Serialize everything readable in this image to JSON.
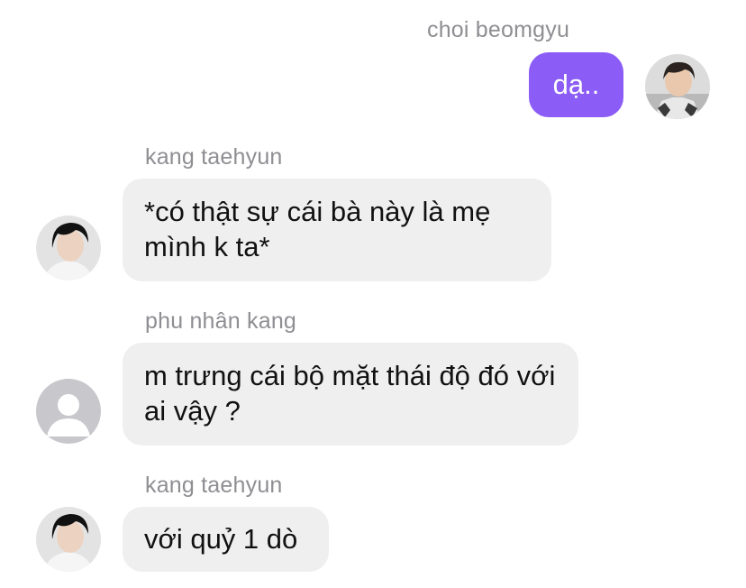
{
  "messages": [
    {
      "sender": "choi beomgyu",
      "text": "dạ..",
      "direction": "outgoing",
      "avatar_icon": "user-photo-avatar-icon"
    },
    {
      "sender": "kang taehyun",
      "text": "*có thật sự cái bà này là mẹ mình k ta*",
      "direction": "incoming",
      "avatar_icon": "user-photo-avatar-icon"
    },
    {
      "sender": "phu nhân kang",
      "text": "m trưng cái bộ mặt thái độ đó với ai vậy ?",
      "direction": "incoming",
      "avatar_icon": "default-user-avatar-icon"
    },
    {
      "sender": "kang taehyun",
      "text": "với quỷ 1 dò",
      "direction": "incoming",
      "avatar_icon": "user-photo-avatar-icon"
    }
  ],
  "colors": {
    "outgoing_bubble": "#8b5cf6",
    "incoming_bubble": "#efefef",
    "sender_name": "#8e8e93",
    "default_avatar_bg": "#c7c7cc"
  }
}
